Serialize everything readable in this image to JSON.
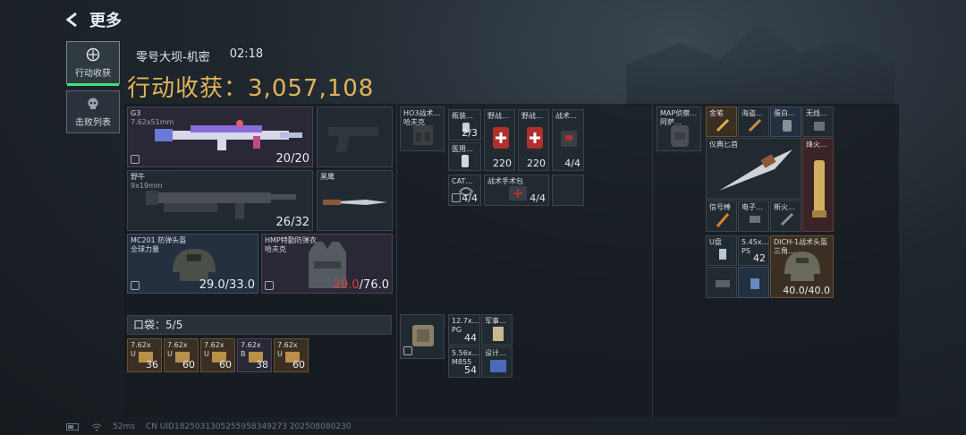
{
  "header": {
    "title": "更多"
  },
  "tabs": [
    {
      "label": "行动收获",
      "active": true
    },
    {
      "label": "击败列表",
      "active": false
    }
  ],
  "session": {
    "map": "零号大坝-机密",
    "time": "02:18"
  },
  "loot": {
    "label": "行动收获：",
    "value": "3,057,108"
  },
  "weapons": {
    "primary": {
      "name": "G3",
      "ammo_type": "7.62x51mm",
      "count": "20/20"
    },
    "secondary": {
      "name": "野牛",
      "ammo_type": "9x19mm",
      "count": "26/32"
    },
    "melee": {
      "name": "黑鹰"
    }
  },
  "armor": {
    "helmet": {
      "name": "MC201 防弹头盔",
      "sub": "全球力量",
      "durability": "29.0/33.0"
    },
    "vest": {
      "name": "HMP特勤防弹衣",
      "sub": "哈夫克",
      "current": "20.0",
      "max": "/76.0"
    }
  },
  "pocket": {
    "label": "口袋：",
    "value": "5/5"
  },
  "pocket_items": [
    {
      "label": "7.62x",
      "sub": "U",
      "count": "36"
    },
    {
      "label": "7.62x",
      "sub": "U",
      "count": "60"
    },
    {
      "label": "7.62x",
      "sub": "U",
      "count": "60"
    },
    {
      "label": "7.62x",
      "sub": "B",
      "count": "38"
    },
    {
      "label": "7.62x",
      "sub": "U",
      "count": "60"
    }
  ],
  "rig": {
    "name": "HO3战术…",
    "sub": "哈夫克",
    "items": [
      {
        "label": "瓶装…",
        "count": "2/3"
      },
      {
        "label": "野战…",
        "count": "220"
      },
      {
        "label": "野战…",
        "count": "220"
      },
      {
        "label": "战术…",
        "count": "4/4"
      },
      {
        "label": "医用…",
        "count": ""
      },
      {
        "label": "CAT…",
        "count": "4/4"
      },
      {
        "label": "战术手术包",
        "count": "4/4"
      }
    ]
  },
  "pouch": {
    "items": [
      {
        "label": "12.7x…",
        "sub": "PG",
        "count": "44"
      },
      {
        "label": "军事…",
        "count": ""
      },
      {
        "label": "5.56x…",
        "sub": "M855",
        "count": "54"
      },
      {
        "label": "设计…",
        "count": ""
      }
    ]
  },
  "backpack": {
    "name": "MAP侦察…",
    "sub": "阿萨…",
    "items": [
      {
        "label": "金笔"
      },
      {
        "label": "海盗…"
      },
      {
        "label": "蛋白…"
      },
      {
        "label": "无线…"
      },
      {
        "label": "仪典匕首"
      },
      {
        "label": "烽火…"
      },
      {
        "label": "信号棒"
      },
      {
        "label": "电子…"
      },
      {
        "label": "新火…"
      },
      {
        "label": "U盘"
      },
      {
        "label": "5.45x…",
        "sub": "PS",
        "count": "42"
      },
      {
        "label": "DICH-1战术头盔",
        "sub": "三角…",
        "count": "40.0/40.0"
      }
    ]
  },
  "footer": {
    "ping": "52ms",
    "uid": "CN UID1825031305255958349273 202508080230"
  },
  "colors": {
    "loot_gold": "#e2b45a",
    "active_tab_underline": "#3fe07a",
    "damage_red": "#e04040"
  }
}
